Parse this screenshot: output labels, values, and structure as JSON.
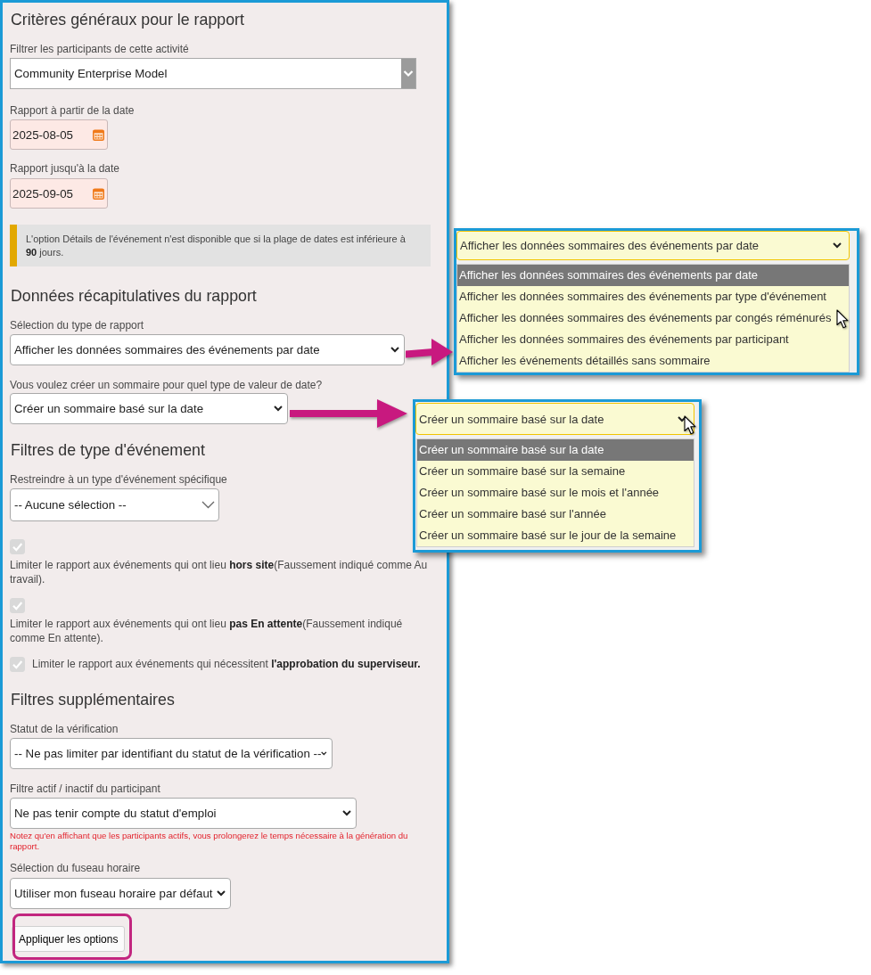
{
  "general_criteria": {
    "title": "Critères généraux pour le rapport",
    "activity_filter": {
      "label": "Filtrer les participants de cette activité",
      "value": "Community Enterprise Model"
    },
    "start_date": {
      "label": "Rapport à partir de la date",
      "value": "2025-08-05"
    },
    "end_date": {
      "label": "Rapport jusqu'à la date",
      "value": "2025-09-05"
    },
    "notice": "L'option Détails de l'événement n'est disponible que si la plage de dates est inférieure à **90** jours."
  },
  "summary_data": {
    "title": "Données récapitulatives du rapport",
    "report_type": {
      "label": "Sélection du type de rapport",
      "value": "Afficher les données sommaires des événements par date"
    },
    "date_grouping": {
      "label": "Vous voulez créer un sommaire pour quel type de valeur de date?",
      "value": "Créer un sommaire basé sur la date"
    }
  },
  "event_type_filters": {
    "title": "Filtres de type d'événement",
    "event_type": {
      "label": "Restreindre à un type d'événement spécifique",
      "value": "-- Aucune sélection --"
    },
    "checkboxes": [
      {
        "kind": "stacked",
        "checked": true,
        "disabled": true,
        "text": "Limiter le rapport aux événements qui ont lieu **hors site**(Faussement indiqué comme Au travail)."
      },
      {
        "kind": "stacked",
        "checked": true,
        "disabled": true,
        "text": "Limiter le rapport aux événements qui ont lieu **pas En attente**(Faussement indiqué comme En attente)."
      },
      {
        "kind": "inline",
        "checked": true,
        "disabled": true,
        "text": "Limiter le rapport aux événements qui nécessitent **l'approbation du superviseur.**"
      }
    ]
  },
  "additional_filters": {
    "title": "Filtres supplémentaires",
    "verification_status": {
      "label": "Statut de la vérification",
      "value": "-- Ne pas limiter par identifiant du statut de la vérification --"
    },
    "participant_status": {
      "label": "Filtre actif / inactif du participant",
      "value": "Ne pas tenir compte du statut d'emploi",
      "note": "Notez qu'en affichant que les participants actifs, vous prolongerez le temps nécessaire à la génération du rapport."
    },
    "time_zone": {
      "label": "Sélection du fuseau horaire",
      "value": "Utiliser mon fuseau horaire par défaut"
    }
  },
  "apply_button": {
    "label": "Appliquer les options"
  },
  "callouts": [
    {
      "value": "Afficher les données sommaires des événements par date",
      "options": [
        {
          "label": "Afficher les données sommaires des événements par date",
          "selected": true
        },
        {
          "label": "Afficher les données sommaires des événements par type d'événement",
          "selected": false
        },
        {
          "label": "Afficher les données sommaires des événements par congés réménurés",
          "selected": false
        },
        {
          "label": "Afficher les données sommaires des événements par participant",
          "selected": false
        },
        {
          "label": "Afficher les événements détaillés sans sommaire",
          "selected": false
        }
      ]
    },
    {
      "value": "Créer un sommaire basé sur la date",
      "options": [
        {
          "label": "Créer un sommaire basé sur la date",
          "selected": true
        },
        {
          "label": "Créer un sommaire basé sur la semaine",
          "selected": false
        },
        {
          "label": "Créer un sommaire basé sur le mois et l'année",
          "selected": false
        },
        {
          "label": "Créer un sommaire basé sur l'année",
          "selected": false
        },
        {
          "label": "Créer un sommaire basé sur le jour de la semaine",
          "selected": false
        }
      ]
    }
  ]
}
